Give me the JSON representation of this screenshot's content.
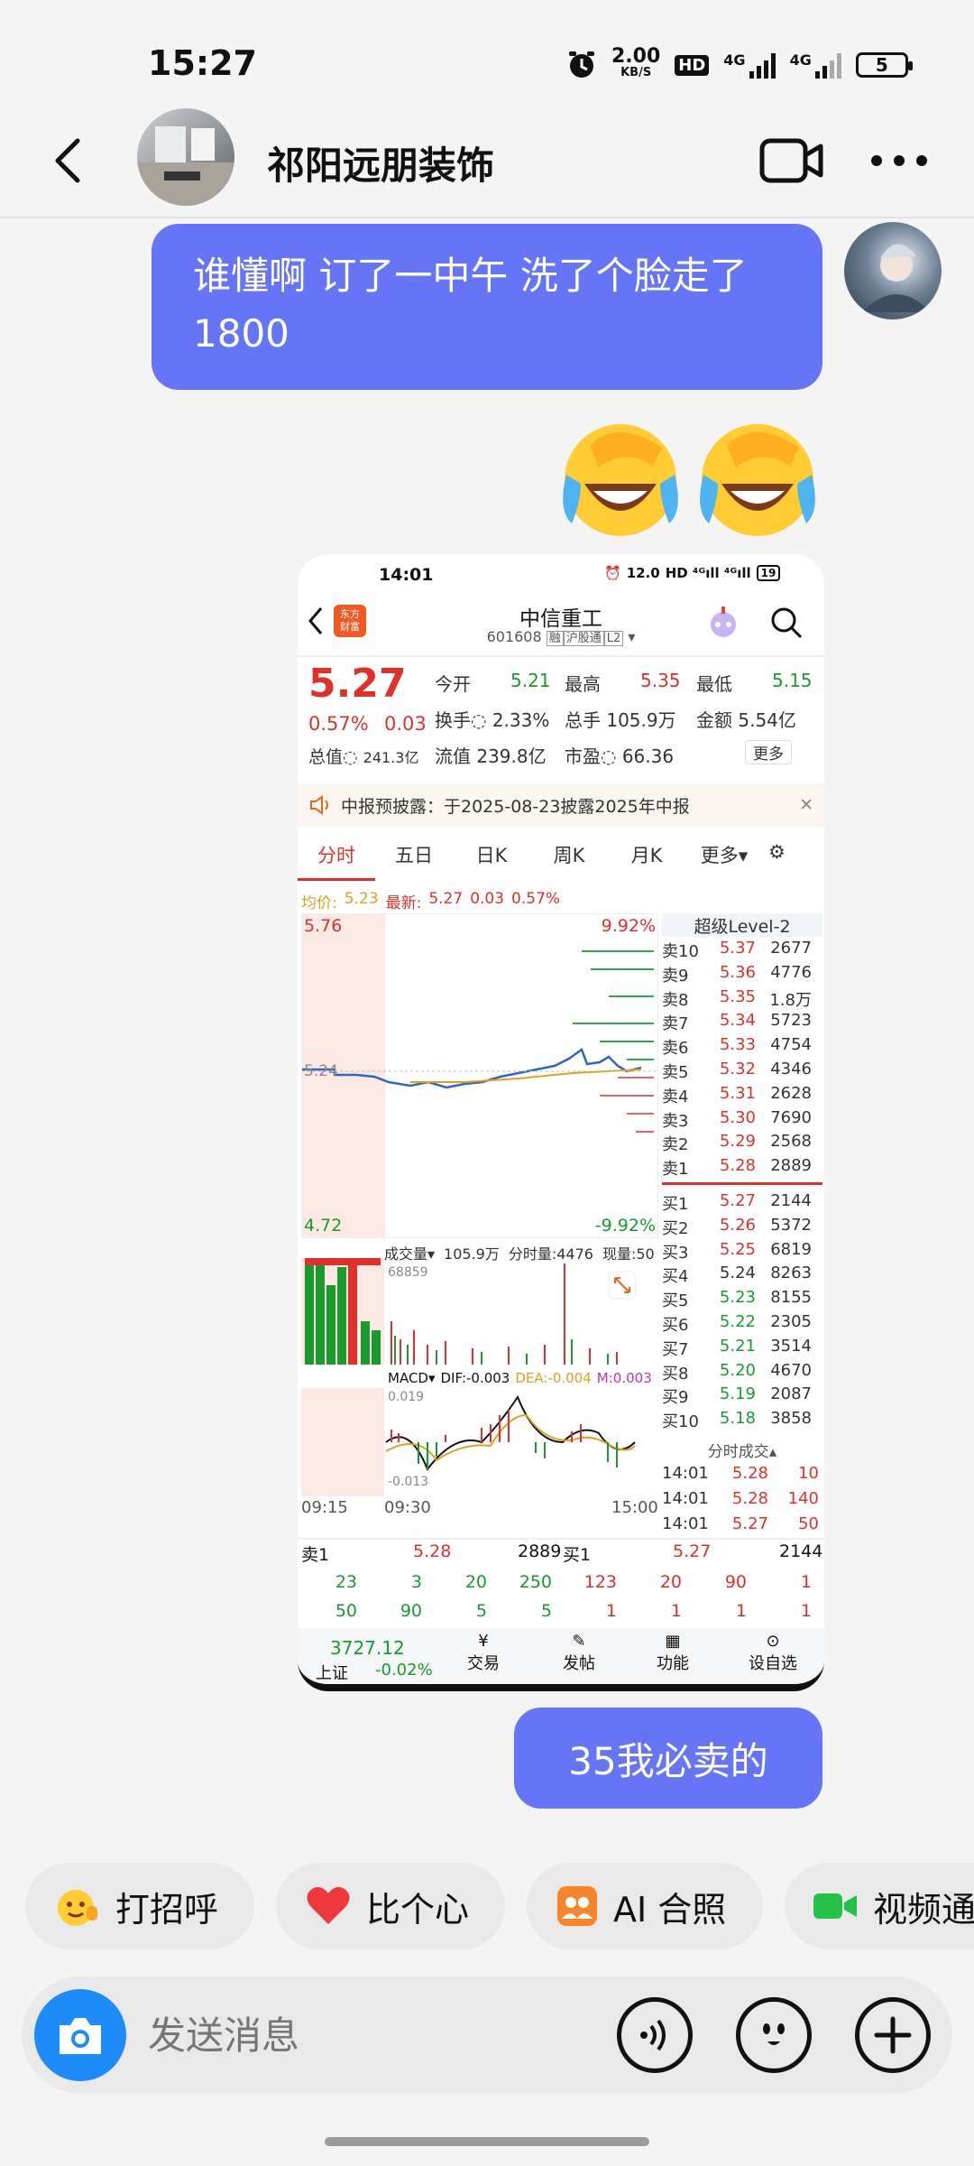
{
  "status_bar": {
    "time": "15:27",
    "net_speed_top": "2.00",
    "net_speed_unit": "KB/S",
    "hd_badge": "HD",
    "sim1": "4G",
    "sim2": "4G",
    "battery": "5"
  },
  "header": {
    "title": "祁阳远朋装饰"
  },
  "messages": [
    {
      "text": "谁懂啊 订了一中午 洗了个脸走了1800"
    },
    {
      "text": "35我必卖的"
    }
  ],
  "stock_screenshot": {
    "status_time": "14:01",
    "status_speed": "12.0",
    "status_battery": "19",
    "logo_line1": "东方",
    "logo_line2": "财富",
    "name": "中信重工",
    "code": "601608",
    "tag_rong": "融",
    "tag_hgt": "沪股通",
    "tag_l2": "L2",
    "price": "5.27",
    "change_pct": "0.57%",
    "change_abs": "0.03",
    "stats": {
      "open_label": "今开",
      "open": "5.21",
      "high_label": "最高",
      "high": "5.35",
      "low_label": "最低",
      "low": "5.15",
      "turnover_label": "换手",
      "turnover": "2.33%",
      "volume_label": "总手",
      "volume": "105.9万",
      "amount_label": "金额",
      "amount": "5.54亿",
      "mktcap_label": "总值",
      "mktcap": "241.3亿",
      "float_label": "流值",
      "float": "239.8亿",
      "pe_label": "市盈",
      "pe": "66.36",
      "more": "更多"
    },
    "notice": "中报预披露：于2025-08-23披露2025年中报",
    "tabs": [
      "分时",
      "五日",
      "日K",
      "周K",
      "月K",
      "更多"
    ],
    "avg_label": "均价:",
    "avg_val": "5.23",
    "latest_label": "最新:",
    "latest_val": "5.27",
    "latest_chg": "0.03",
    "latest_pct": "0.57%",
    "chart_top": "5.76",
    "chart_bottom": "4.72",
    "chart_top_pct": "9.92%",
    "chart_bottom_pct": "-9.92%",
    "chart_mid": "5.24",
    "level2_title": "超级Level-2",
    "vol_label": "成交量",
    "vol_total": "105.9万",
    "vol_tick": "分时量:4476",
    "vol_now": "现量:50",
    "vol_max": "68859",
    "macd_label": "MACD",
    "dif": "DIF:-0.003",
    "dea": "DEA:-0.004",
    "m": "M:0.003",
    "macd_top": "0.019",
    "macd_bottom": "-0.013",
    "time_start": "09:15",
    "time_open": "09:30",
    "time_end": "15:00",
    "asks": [
      {
        "label": "卖10",
        "price": "5.37",
        "vol": "2677"
      },
      {
        "label": "卖9",
        "price": "5.36",
        "vol": "4776"
      },
      {
        "label": "卖8",
        "price": "5.35",
        "vol": "1.8万"
      },
      {
        "label": "卖7",
        "price": "5.34",
        "vol": "5723"
      },
      {
        "label": "卖6",
        "price": "5.33",
        "vol": "4754"
      },
      {
        "label": "卖5",
        "price": "5.32",
        "vol": "4346"
      },
      {
        "label": "卖4",
        "price": "5.31",
        "vol": "2628"
      },
      {
        "label": "卖3",
        "price": "5.30",
        "vol": "7690"
      },
      {
        "label": "卖2",
        "price": "5.29",
        "vol": "2568"
      },
      {
        "label": "卖1",
        "price": "5.28",
        "vol": "2889"
      }
    ],
    "bids": [
      {
        "label": "买1",
        "price": "5.27",
        "vol": "2144"
      },
      {
        "label": "买2",
        "price": "5.26",
        "vol": "5372"
      },
      {
        "label": "买3",
        "price": "5.25",
        "vol": "6819"
      },
      {
        "label": "买4",
        "price": "5.24",
        "vol": "8263"
      },
      {
        "label": "买5",
        "price": "5.23",
        "vol": "8155"
      },
      {
        "label": "买6",
        "price": "5.22",
        "vol": "2305"
      },
      {
        "label": "买7",
        "price": "5.21",
        "vol": "3514"
      },
      {
        "label": "买8",
        "price": "5.20",
        "vol": "4670"
      },
      {
        "label": "买9",
        "price": "5.19",
        "vol": "2087"
      },
      {
        "label": "买10",
        "price": "5.18",
        "vol": "3858"
      }
    ],
    "trades_title": "分时成交",
    "trades": [
      {
        "time": "14:01",
        "price": "5.28",
        "vol": "10"
      },
      {
        "time": "14:01",
        "price": "5.28",
        "vol": "140"
      },
      {
        "time": "14:01",
        "price": "5.27",
        "vol": "50"
      }
    ],
    "bottom_ask_label": "卖1",
    "bottom_ask_price": "5.28",
    "bottom_ask_vol": "2889",
    "bottom_bid_label": "买1",
    "bottom_bid_price": "5.27",
    "bottom_bid_vol": "2144",
    "queue_row1": [
      "23",
      "3",
      "20",
      "250",
      "123",
      "20",
      "90",
      "1"
    ],
    "queue_row2": [
      "50",
      "90",
      "5",
      "5",
      "1",
      "1",
      "1",
      "1"
    ],
    "index_value": "3727.12",
    "index_name": "上证",
    "index_chg": "-0.02%",
    "bottom_nav": [
      "交易",
      "发帖",
      "功能",
      "设自选"
    ]
  },
  "quick_actions": [
    "打招呼",
    "比个心",
    "AI 合照",
    "视频通"
  ],
  "input": {
    "placeholder": "发送消息"
  }
}
